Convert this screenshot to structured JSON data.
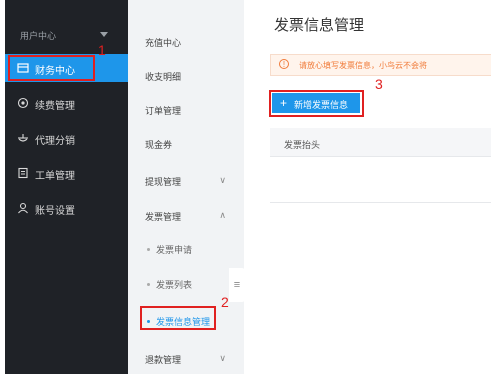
{
  "sidebar": {
    "header": "用户中心",
    "items": [
      {
        "label": "财务中心",
        "icon": "wallet-icon",
        "active": true
      },
      {
        "label": "续费管理",
        "icon": "renew-icon",
        "active": false
      },
      {
        "label": "代理分销",
        "icon": "agent-icon",
        "active": false
      },
      {
        "label": "工单管理",
        "icon": "ticket-icon",
        "active": false
      },
      {
        "label": "账号设置",
        "icon": "user-icon",
        "active": false
      }
    ]
  },
  "submenu": {
    "items": [
      {
        "label": "充值中心"
      },
      {
        "label": "收支明细"
      },
      {
        "label": "订单管理"
      },
      {
        "label": "现金券"
      },
      {
        "label": "提现管理",
        "chevron": "∨"
      },
      {
        "label": "发票管理",
        "chevron": "∧"
      },
      {
        "label": "退款管理",
        "chevron": "∨"
      }
    ],
    "children": [
      {
        "label": "发票申请",
        "active": false
      },
      {
        "label": "发票列表",
        "active": false
      },
      {
        "label": "发票信息管理",
        "active": true
      }
    ],
    "collapse_glyph": "≡"
  },
  "main": {
    "title": "发票信息管理",
    "warning": "请放心填写发票信息，小鸟云不会将",
    "warning_icon": "!",
    "new_button": "新增发票信息",
    "new_button_icon": "+",
    "table_header": "发票抬头",
    "table_empty": ""
  },
  "annotations": [
    "1",
    "2",
    "3"
  ],
  "colors": {
    "accent": "#1e96ea",
    "sidebar_bg": "#1f2227",
    "annotation": "#e02020",
    "warning": "#f07b3a"
  }
}
